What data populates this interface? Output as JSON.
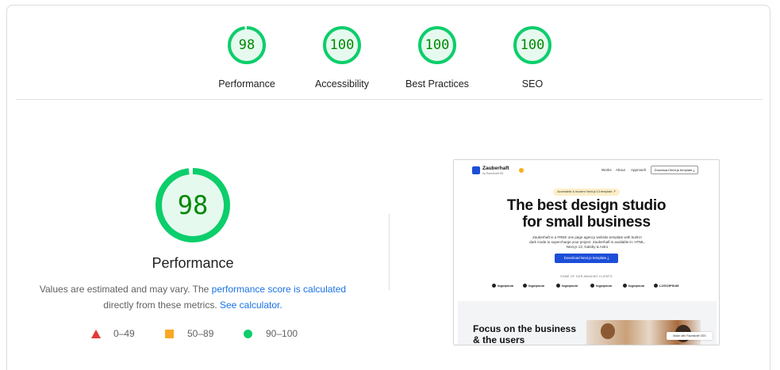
{
  "summary_gauges": [
    {
      "score": "98",
      "label": "Performance",
      "fraction": 0.98
    },
    {
      "score": "100",
      "label": "Accessibility",
      "fraction": 1.0
    },
    {
      "score": "100",
      "label": "Best Practices",
      "fraction": 1.0
    },
    {
      "score": "100",
      "label": "SEO",
      "fraction": 1.0
    }
  ],
  "performance": {
    "score": "98",
    "fraction": 0.98,
    "title": "Performance",
    "desc_before": "Values are estimated and may vary. The ",
    "desc_link1": "performance score is calculated",
    "desc_middle": " directly from these metrics. ",
    "desc_link2": "See calculator."
  },
  "legend": [
    {
      "range": "0–49",
      "icon": "red-triangle-icon",
      "color": "#e53935"
    },
    {
      "range": "50–89",
      "icon": "orange-square-icon",
      "color": "#f9a825"
    },
    {
      "range": "90–100",
      "icon": "green-circle-icon",
      "color": "#0cce6b"
    }
  ],
  "colors": {
    "pass_ring": "#0cce6b",
    "pass_fill": "#e6f9ef",
    "pass_text": "#008800",
    "link": "#1a73e8"
  },
  "screenshot": {
    "brand": "Zauberhaft",
    "brand_sub": "by Raumkraft DE",
    "nav_links": [
      "Works",
      "About",
      "Approach"
    ],
    "nav_button": "Download Next.js template ⤓",
    "pill": "Accessible & modern Next.js 13 template ↗",
    "hero_line1": "The best design studio",
    "hero_line2": "for small business",
    "hero_sub": "Zauberhaft is a FREE one page agency website template with built-in dark mode to supercharge your project. Zauberhaft is available in: HTML, Next.js 13, Gatsby & Astro",
    "cta": "Download Next.js template ⤓",
    "clients_label": "SOME OF OUR AMAZING CLIENTS",
    "clients": [
      "logoipsum",
      "logoipsum",
      "logoipsum",
      "logoipsum",
      "logoipsum",
      "LOGOIPSUM"
    ],
    "section_title_1": "Focus on the business",
    "section_title_2": "& the users",
    "badge": "Made with Raumkraft OSS"
  }
}
